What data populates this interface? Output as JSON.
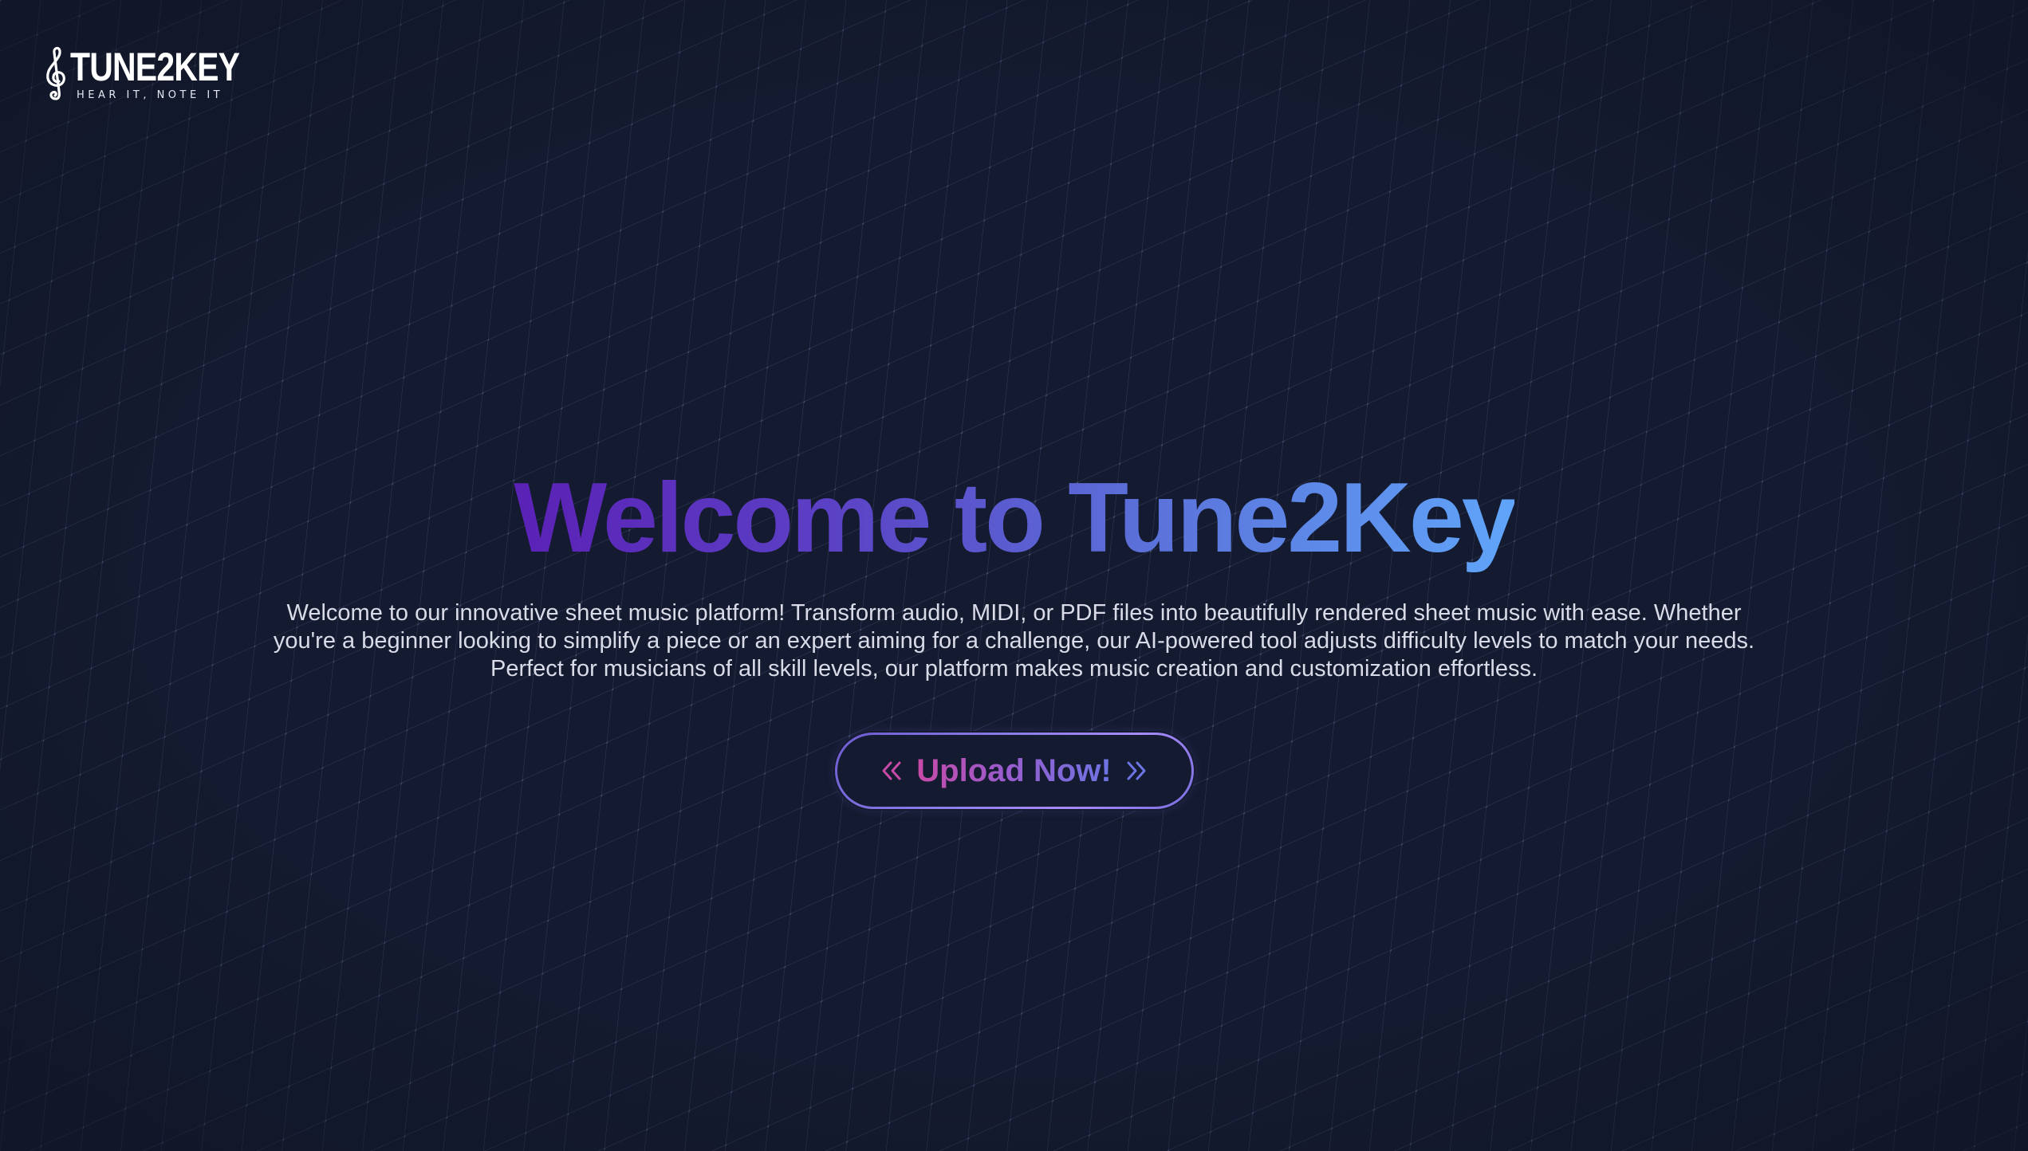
{
  "brand": {
    "name": "TUNE2KEY",
    "tagline": "HEAR IT, NOTE IT",
    "logo_icon": "treble-clef-icon"
  },
  "hero": {
    "title": "Welcome to Tune2Key",
    "description": "Welcome to our innovative sheet music platform! Transform audio, MIDI, or PDF files into beautifully rendered sheet music with ease. Whether you're a beginner looking to simplify a piece or an expert aiming for a challenge, our AI-powered tool adjusts difficulty levels to match your needs. Perfect for musicians of all skill levels, our platform makes music creation and customization effortless.",
    "cta": {
      "label": "Upload Now!",
      "left_icon": "double-chevron-left-icon",
      "right_icon": "double-chevron-right-icon"
    }
  },
  "colors": {
    "background": "#141a2f",
    "grid_line": "#3a4260",
    "title_gradient_start": "#5b21b6",
    "title_gradient_end": "#60a5fa",
    "cta_gradient_start": "#c84aa8",
    "cta_gradient_end": "#6d74e3",
    "text": "#d9dce8"
  }
}
